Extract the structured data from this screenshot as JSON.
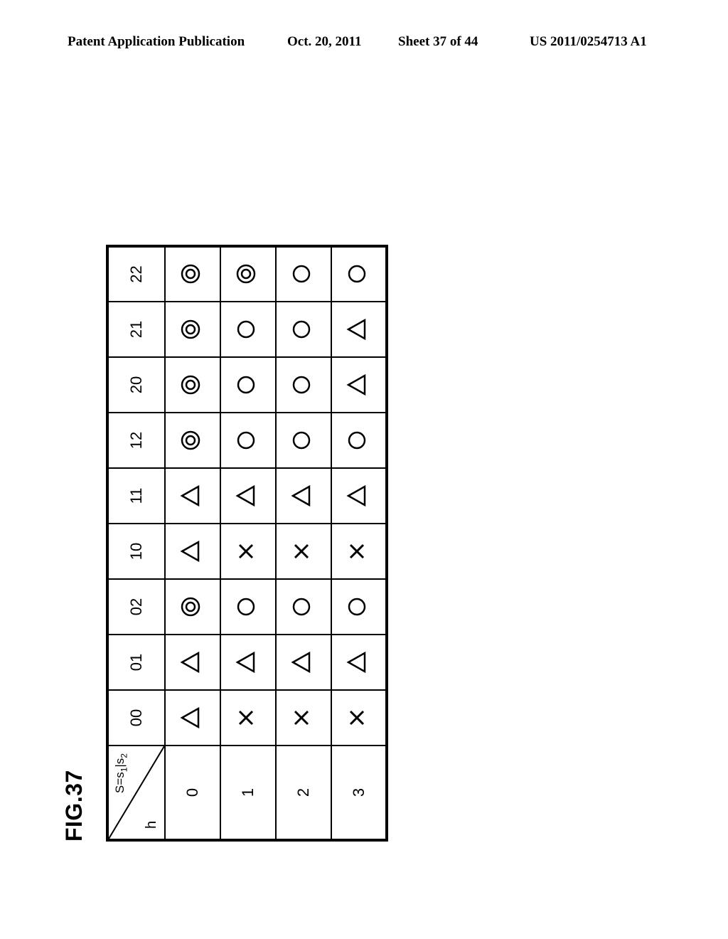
{
  "header": {
    "left": "Patent Application Publication",
    "date": "Oct. 20, 2011",
    "sheet": "Sheet 37 of 44",
    "pubno": "US 2011/0254713 A1"
  },
  "figure": {
    "label": "FIG.37",
    "corner_top": "S=s₁|s₂",
    "corner_bottom": "h",
    "col_headers": [
      "00",
      "01",
      "02",
      "10",
      "11",
      "12",
      "20",
      "21",
      "22"
    ],
    "row_headers": [
      "0",
      "1",
      "2",
      "3"
    ],
    "cells": [
      [
        "triangle",
        "triangle",
        "double-circle",
        "triangle",
        "triangle",
        "double-circle",
        "double-circle",
        "double-circle",
        "double-circle"
      ],
      [
        "cross",
        "triangle",
        "circle",
        "cross",
        "triangle",
        "circle",
        "circle",
        "circle",
        "double-circle"
      ],
      [
        "cross",
        "triangle",
        "circle",
        "cross",
        "triangle",
        "circle",
        "circle",
        "circle",
        "circle"
      ],
      [
        "cross",
        "triangle",
        "circle",
        "cross",
        "triangle",
        "circle",
        "triangle",
        "triangle",
        "circle"
      ]
    ]
  }
}
